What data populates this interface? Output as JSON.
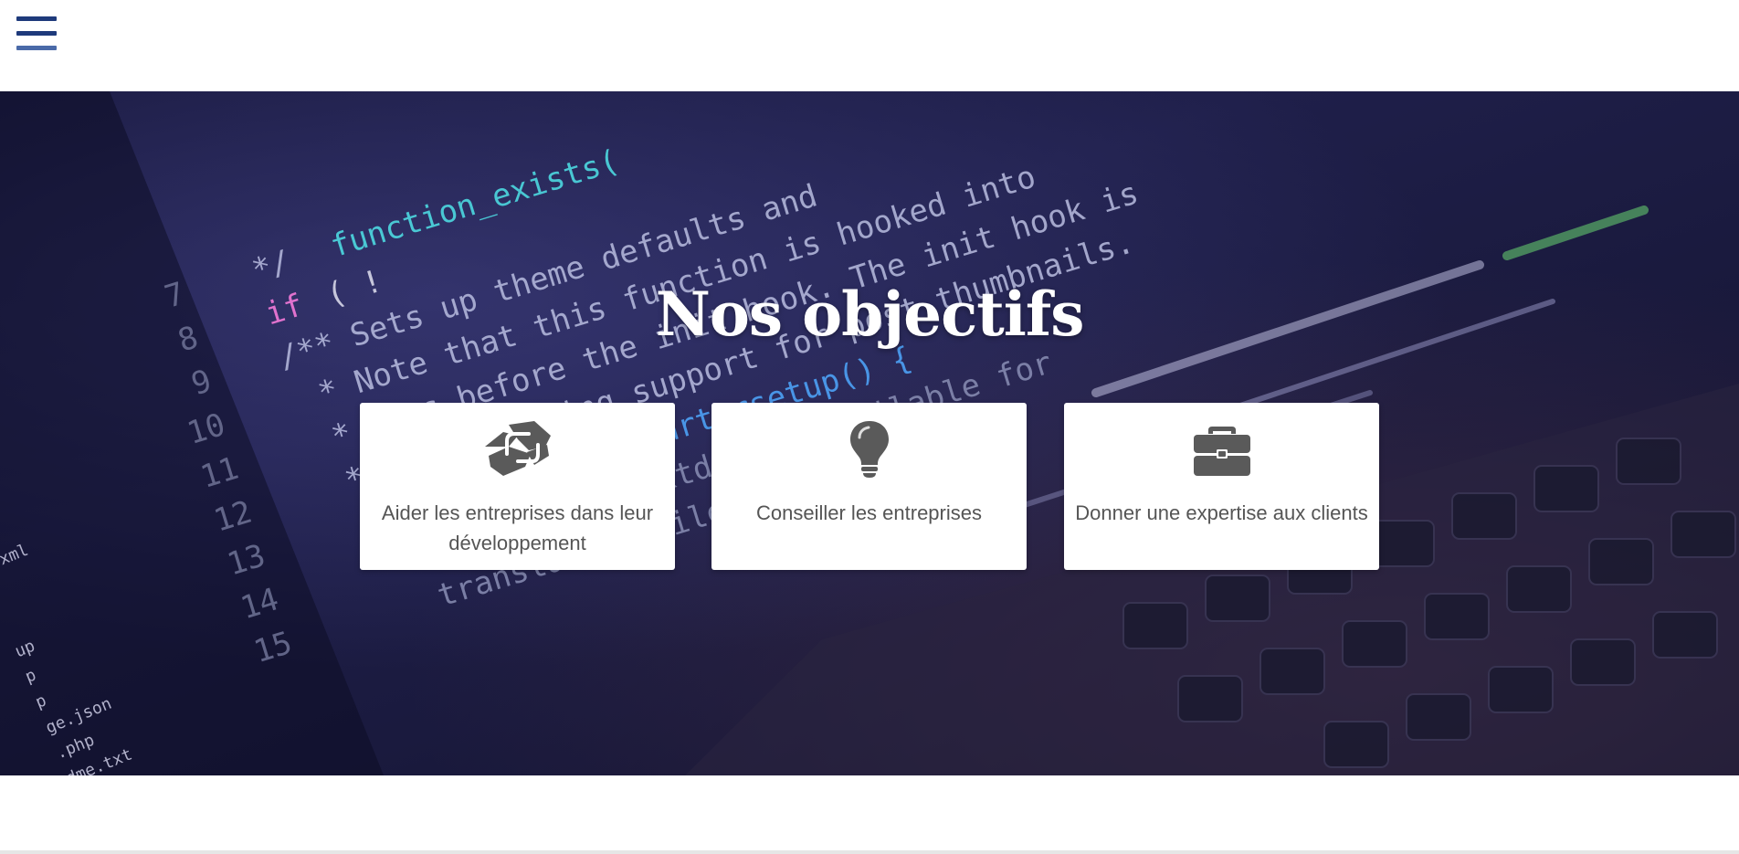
{
  "header": {
    "menu_icon": "hamburger-menu-icon"
  },
  "hero": {
    "title": "Nos objectifs"
  },
  "cards": [
    {
      "icon": "handshake-icon",
      "label": "Aider les entreprises dans leur développement"
    },
    {
      "icon": "lightbulb-icon",
      "label": "Conseiller les entreprises"
    },
    {
      "icon": "briefcase-icon",
      "label": "Donner une expertise aux clients"
    }
  ],
  "colors": {
    "menu_icon": "#1e3a7b",
    "card_icon": "#5a5a5a",
    "card_text": "#555555",
    "title": "#ffffff"
  }
}
